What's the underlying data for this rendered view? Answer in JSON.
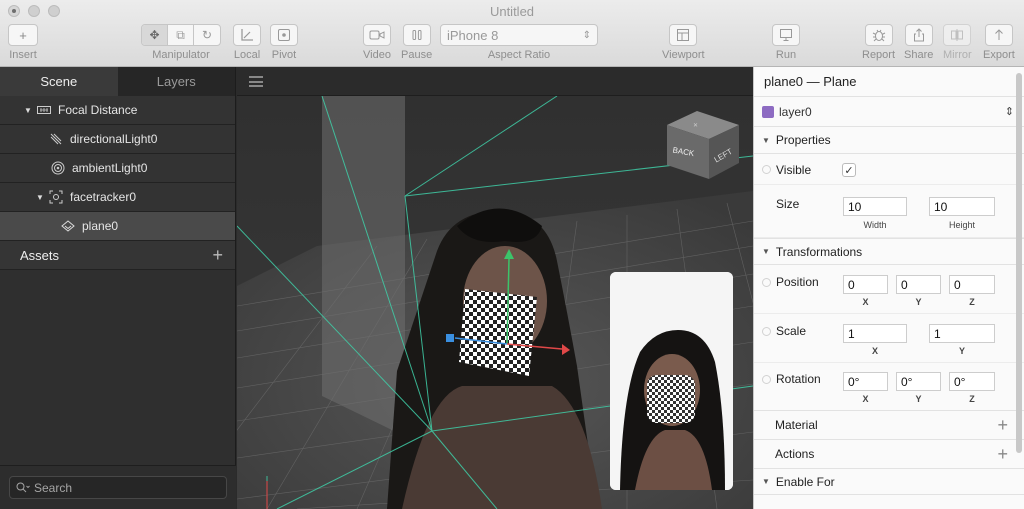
{
  "window": {
    "title": "Untitled"
  },
  "toolbar": {
    "insert": "Insert",
    "manipulator": "Manipulator",
    "local": "Local",
    "pivot": "Pivot",
    "video": "Video",
    "pause": "Pause",
    "aspect_ratio": "Aspect Ratio",
    "device": "iPhone 8",
    "viewport": "Viewport",
    "run": "Run",
    "report": "Report",
    "share": "Share",
    "mirror": "Mirror",
    "export": "Export"
  },
  "left_panel": {
    "tabs": [
      "Scene",
      "Layers"
    ],
    "active_tab": "Scene",
    "tree": [
      {
        "label": "Focal Distance",
        "icon": "focal-distance-icon",
        "expanded": true
      },
      {
        "label": "directionalLight0",
        "icon": "directional-light-icon"
      },
      {
        "label": "ambientLight0",
        "icon": "ambient-light-icon"
      },
      {
        "label": "facetracker0",
        "icon": "facetracker-icon",
        "expanded": true
      },
      {
        "label": "plane0",
        "icon": "plane-icon",
        "selected": true
      }
    ],
    "assets_label": "Assets",
    "search_placeholder": "Search"
  },
  "inspector": {
    "title": "plane0 — Plane",
    "layer": "layer0",
    "layer_color": "#8d6bc2",
    "properties_label": "Properties",
    "visible_label": "Visible",
    "visible_checked": true,
    "size_label": "Size",
    "size": {
      "width": "10",
      "height": "10",
      "width_label": "Width",
      "height_label": "Height"
    },
    "transformations_label": "Transformations",
    "position_label": "Position",
    "position": {
      "x": "0",
      "y": "0",
      "z": "0"
    },
    "scale_label": "Scale",
    "scale": {
      "x": "1",
      "y": "1"
    },
    "rotation_label": "Rotation",
    "rotation": {
      "x": "0°",
      "y": "0°",
      "z": "0°"
    },
    "axes": {
      "x": "X",
      "y": "Y",
      "z": "Z"
    },
    "material_label": "Material",
    "actions_label": "Actions",
    "enable_for_label": "Enable For"
  },
  "view_cube": {
    "back": "BACK",
    "left": "LEFT"
  },
  "colors": {
    "guide_lines": "#3fcfa8",
    "gizmo_x": "#e04848",
    "gizmo_y": "#3cc46a",
    "gizmo_z": "#3a8fe0"
  }
}
